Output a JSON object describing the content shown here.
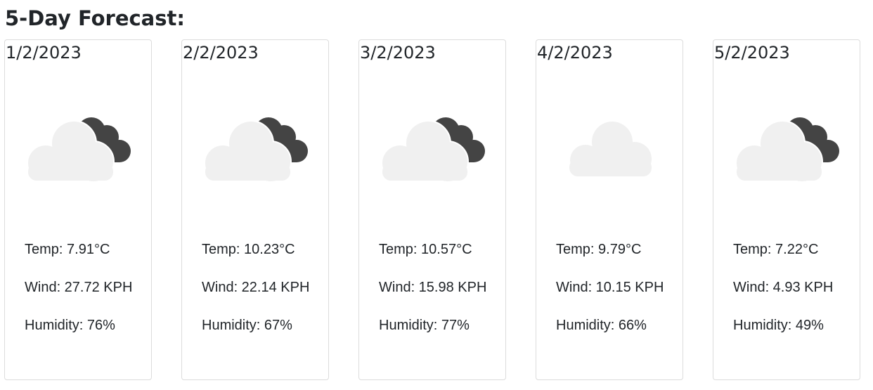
{
  "page": {
    "heading": "5-Day Forecast:"
  },
  "days": [
    {
      "date": "1/2/2023",
      "icon": "cloud-moon-icon",
      "temp": "Temp: 7.91°C",
      "wind": "Wind: 27.72 KPH",
      "humidity": "Humidity: 76%"
    },
    {
      "date": "2/2/2023",
      "icon": "cloud-moon-icon",
      "temp": "Temp: 10.23°C",
      "wind": "Wind: 22.14 KPH",
      "humidity": "Humidity: 67%"
    },
    {
      "date": "3/2/2023",
      "icon": "cloud-moon-icon",
      "temp": "Temp: 10.57°C",
      "wind": "Wind: 15.98 KPH",
      "humidity": "Humidity: 77%"
    },
    {
      "date": "4/2/2023",
      "icon": "cloud-icon",
      "temp": "Temp: 9.79°C",
      "wind": "Wind: 10.15 KPH",
      "humidity": "Humidity: 66%"
    },
    {
      "date": "5/2/2023",
      "icon": "cloud-moon-icon",
      "temp": "Temp: 7.22°C",
      "wind": "Wind: 4.93 KPH",
      "humidity": "Humidity: 49%"
    }
  ],
  "colors": {
    "cloud_light": "#f0f0f0",
    "cloud_dark": "#444444",
    "card_border": "#dcdcdc",
    "text": "#212529"
  }
}
